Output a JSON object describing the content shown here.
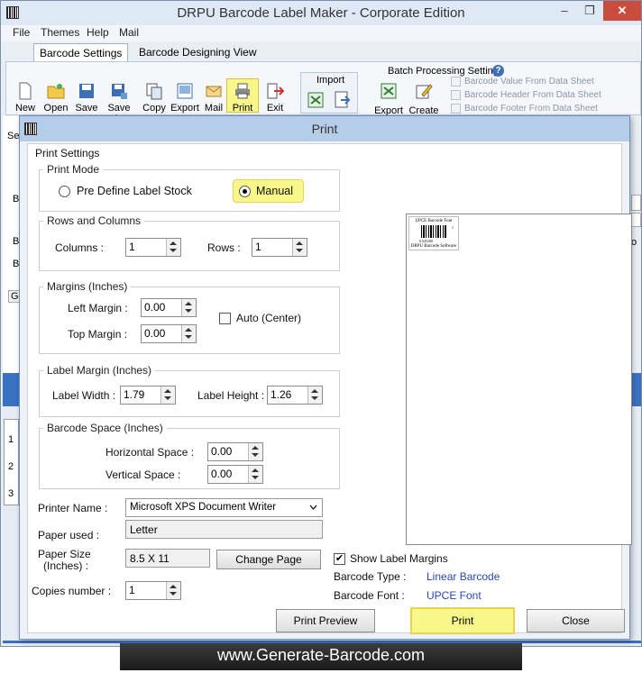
{
  "app": {
    "title": "DRPU Barcode Label Maker - Corporate Edition",
    "window_controls": {
      "minimize": "–",
      "restore": "❐",
      "close": "✕"
    }
  },
  "menu": [
    "File",
    "Themes",
    "Help",
    "Mail"
  ],
  "tabs": [
    "Barcode Settings",
    "Barcode Designing View"
  ],
  "toolbar": {
    "buttons": [
      "New",
      "Open",
      "Save",
      "Save As",
      "Copy",
      "Export",
      "Mail",
      "Print",
      "Exit"
    ],
    "active": "Print"
  },
  "import_group": {
    "label": "Import"
  },
  "batch": {
    "title": "Batch Processing Settings",
    "export_label": "Export",
    "create_list_label": "Create List",
    "options": [
      "Barcode Value From Data Sheet",
      "Barcode Header From Data Sheet",
      "Barcode Footer From Data Sheet"
    ]
  },
  "background_fragments": {
    "se": "Se",
    "ba1": "Ba",
    "ba2": "Ba",
    "ba3": "Ba",
    "ge": "Ge",
    "o": "o",
    "ruler": [
      "1",
      "2",
      "3"
    ]
  },
  "dialog": {
    "title": "Print",
    "print_settings_label": "Print Settings",
    "print_mode": {
      "legend": "Print Mode",
      "options": [
        "Pre Define Label Stock",
        "Manual"
      ],
      "selected": "Manual"
    },
    "rows_columns": {
      "legend": "Rows and Columns",
      "columns_label": "Columns :",
      "columns_value": "1",
      "rows_label": "Rows :",
      "rows_value": "1"
    },
    "margins": {
      "legend": "Margins (Inches)",
      "left_label": "Left Margin :",
      "left_value": "0.00",
      "top_label": "Top Margin :",
      "top_value": "0.00",
      "auto_label": "Auto (Center)",
      "auto_checked": false
    },
    "label_margin": {
      "legend": "Label Margin (Inches)",
      "width_label": "Label Width :",
      "width_value": "1.79",
      "height_label": "Label Height :",
      "height_value": "1.26"
    },
    "barcode_space": {
      "legend": "Barcode Space (Inches)",
      "horizontal_label": "Horizontal Space :",
      "horizontal_value": "0.00",
      "vertical_label": "Vertical Space :",
      "vertical_value": "0.00"
    },
    "printer_name_label": "Printer Name :",
    "printer_name_value": "Microsoft XPS Document Writer",
    "paper_used_label": "Paper used :",
    "paper_used_value": "Letter",
    "paper_size_label_line1": "Paper Size",
    "paper_size_label_line2": "(Inches) :",
    "paper_size_value": "8.5 X 11",
    "change_page_label": "Change Page",
    "copies_label": "Copies number :",
    "copies_value": "1",
    "show_label_margins_label": "Show Label Margins",
    "show_label_margins_checked": true,
    "barcode_type_label": "Barcode Type :",
    "barcode_type_value": "Linear Barcode",
    "barcode_font_label": "Barcode Font :",
    "barcode_font_value": "UPCE Font",
    "preview": {
      "header": "UPCE Barcode Font",
      "digits": "0  645200",
      "check": "1",
      "footer": "DRPU Barcode Software"
    },
    "buttons": {
      "preview": "Print Preview",
      "print": "Print",
      "close": "Close"
    }
  },
  "footer": {
    "text": "www.Generate-Barcode.com"
  },
  "colors": {
    "accent_highlight": "#f7f78a",
    "link": "#2b46b8",
    "title_bar": "#b5cde8"
  }
}
